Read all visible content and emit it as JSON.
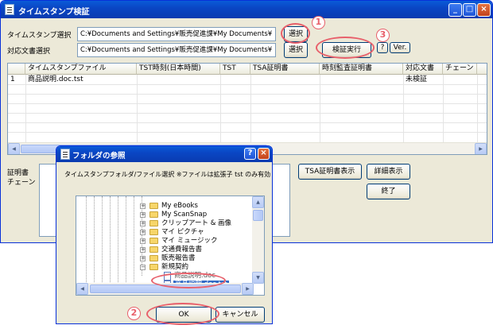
{
  "window": {
    "title": "タイムスタンプ検証",
    "controls": {
      "minimize": "_",
      "maximize": "□",
      "close": "×"
    }
  },
  "form": {
    "timestamp_label": "タイムスタンプ選択",
    "timestamp_path": "C:¥Documents and Settings¥販売促進課¥My Documents¥",
    "doc_label": "対応文書選択",
    "doc_path": "C:¥Documents and Settings¥販売促進課¥My Documents¥",
    "select_label": "選択",
    "verify_label": "検証実行",
    "help_label": "?",
    "ver_label": "Ver."
  },
  "table": {
    "columns": [
      "タイムスタンプファイル",
      "TST時刻(日本時間)",
      "TST",
      "TSA証明書",
      "時刻監査証明書",
      "対応文書",
      "チェーン"
    ],
    "rows": [
      {
        "no": "1",
        "file": "商品説明.doc.tst",
        "status": "未検証"
      }
    ]
  },
  "lower": {
    "cert_label": "証明書",
    "chain_label": "チェーン",
    "tsa_cert_btn": "TSA証明書表示",
    "detail_btn": "詳細表示",
    "close_btn": "終了"
  },
  "dialog": {
    "title": "フォルダの参照",
    "help": "?",
    "close": "×",
    "instruction": "タイムスタンプフォルダ/ファイル選択 ※ファイルは拡張子 tst のみ有効",
    "tree": [
      {
        "label": "My eBooks",
        "type": "folder"
      },
      {
        "label": "My ScanSnap",
        "type": "folder"
      },
      {
        "label": "クリップアート & 画像",
        "type": "folder"
      },
      {
        "label": "マイ ピクチャ",
        "type": "folder"
      },
      {
        "label": "マイ ミュージック",
        "type": "folder"
      },
      {
        "label": "交通費報告書",
        "type": "folder"
      },
      {
        "label": "販売報告書",
        "type": "folder"
      },
      {
        "label": "新規契約",
        "type": "folder"
      },
      {
        "label": "商品説明.doc",
        "type": "doc"
      },
      {
        "label": "商品説明.doc.tst",
        "type": "tst"
      }
    ],
    "ok": "OK",
    "cancel": "キャンセル"
  },
  "callouts": [
    "1",
    "2",
    "3"
  ],
  "colors": {
    "accent": "#e8606b",
    "titlebar": "#0a46c4",
    "selection": "#316ac5"
  }
}
